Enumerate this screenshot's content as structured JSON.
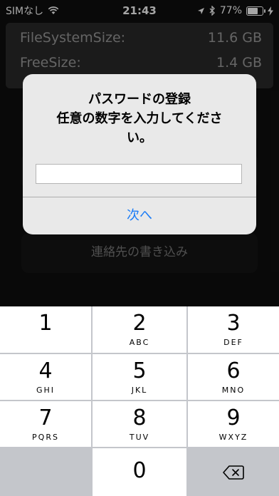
{
  "status_bar": {
    "carrier": "SIMなし",
    "time": "21:43",
    "battery_percent": "77%",
    "battery_level": 0.77
  },
  "info": {
    "rows": [
      {
        "label": "FileSystemSize:",
        "value": "11.6 GB"
      },
      {
        "label": "FreeSize:",
        "value": "1.4 GB"
      }
    ]
  },
  "background_buttons": {
    "contacts_write": "連絡先の書き込み"
  },
  "alert": {
    "title": "パスワードの登録\n任意の数字を入力してくださ\nい。",
    "input_value": "",
    "action_label": "次へ"
  },
  "keypad": {
    "keys": [
      {
        "num": "1",
        "letters": ""
      },
      {
        "num": "2",
        "letters": "ABC"
      },
      {
        "num": "3",
        "letters": "DEF"
      },
      {
        "num": "4",
        "letters": "GHI"
      },
      {
        "num": "5",
        "letters": "JKL"
      },
      {
        "num": "6",
        "letters": "MNO"
      },
      {
        "num": "7",
        "letters": "PQRS"
      },
      {
        "num": "8",
        "letters": "TUV"
      },
      {
        "num": "9",
        "letters": "WXYZ"
      },
      {
        "num": "0",
        "letters": ""
      }
    ]
  },
  "colors": {
    "accent": "#1b7cf6",
    "keypad_bg": "#c4c6cb"
  }
}
